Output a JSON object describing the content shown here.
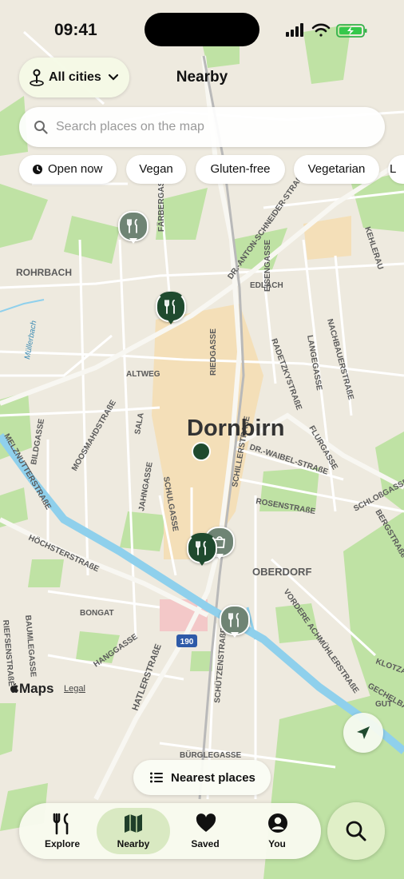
{
  "status_bar": {
    "time": "09:41"
  },
  "header": {
    "city_selector_label": "All cities",
    "title": "Nearby"
  },
  "search": {
    "placeholder": "Search places on the map"
  },
  "filters": [
    {
      "label": "Open now"
    },
    {
      "label": "Vegan"
    },
    {
      "label": "Gluten-free"
    },
    {
      "label": "Vegetarian"
    },
    {
      "label": "L"
    }
  ],
  "map": {
    "labels": {
      "city": "Dornbirn",
      "rohrbach": "ROHRBACH",
      "oberdorf": "OBERDORF",
      "edlach": "EDLACH",
      "altweg": "ALTWEG",
      "faerbergasse": "FÄRBERGASSE",
      "anton_schneider": "DR.-ANTON-SCHNEIDER-STRAßE",
      "kehlerau": "KEHLERAU",
      "muellerbach": "Müllerbach",
      "eisengasse": "EISENGASSE",
      "riedgasse": "RIEDGASSE",
      "radetzky": "RADETZKYSTRAßE",
      "langegasse": "LANGEGASSE",
      "nachbauer": "NACHBAUERSTRAßE",
      "bildgasse": "BILDGASSE",
      "moosmahd": "MOOSMAHDSTRAßE",
      "sala": "SALA",
      "jahngasse": "JAHNGASSE",
      "schulgasse": "SCHULGASSE",
      "flurgasse": "FLURGASSE",
      "waibel": "DR.-WAIBEL-STRAßE",
      "schlossgasse": "SCHLOßGASSE",
      "bergstrasse": "BERGSTRAße",
      "schiller": "SCHILLERSTRAßE",
      "rosen": "ROSENSTRAßE",
      "melz": "MELZNUTTERSTRAßE",
      "hoechster": "HÖCHSTERSTRAßE",
      "bongat": "BONGAT",
      "baumle": "BAUMLEGASSE",
      "riefsen": "RIEFSENSTRAßE",
      "hangasse": "HANGGASSE",
      "hatler": "HATLERSTRAßE",
      "schuetzen": "SCHÜTZENSTRAßE",
      "vordere": "VORDERE ACHMÜHLERSTRAßE",
      "klotzacker": "KLOTZAC",
      "gechelbach": "GECHELBACH",
      "buerglegasse": "BÜRGLEGASSE",
      "gut": "GUT",
      "route_badge": "190"
    },
    "attribution": {
      "logo": "Maps",
      "legal": "Legal"
    }
  },
  "nearest_button": {
    "label": "Nearest places"
  },
  "tab_bar": {
    "tabs": [
      {
        "label": "Explore",
        "icon": "fork-knife-icon"
      },
      {
        "label": "Nearby",
        "icon": "map-icon",
        "selected": true
      },
      {
        "label": "Saved",
        "icon": "heart-icon"
      },
      {
        "label": "You",
        "icon": "person-circle-icon"
      }
    ]
  },
  "colors": {
    "pin_dark": "#1f4a2e",
    "pin_grey": "#6f8474",
    "river": "#8fd0ec",
    "park": "#bfe2a4"
  }
}
